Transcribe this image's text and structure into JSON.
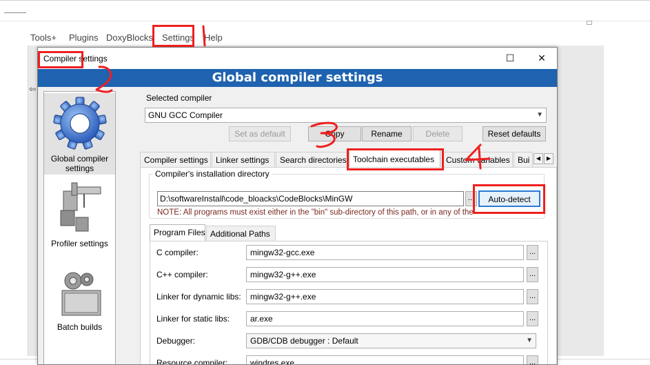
{
  "background": {
    "menu": [
      "Tools+",
      "Plugins",
      "DoxyBlocks",
      "Settings",
      "Help"
    ],
    "arrow_glyph": "⇦"
  },
  "dialog": {
    "title": "Compiler settings",
    "maximize_glyph": "☐",
    "close_glyph": "✕",
    "banner": "Global compiler settings",
    "categories": [
      {
        "label": "Global compiler settings",
        "icon": "gear-icon"
      },
      {
        "label": "Profiler settings",
        "icon": "profiler-icon"
      },
      {
        "label": "Batch builds",
        "icon": "batch-builds-icon"
      }
    ],
    "selected_compiler_label": "Selected compiler",
    "selected_compiler": "GNU GCC Compiler",
    "buttons": {
      "set_default": "Set as default",
      "copy": "Copy",
      "rename": "Rename",
      "delete": "Delete",
      "reset_defaults": "Reset defaults"
    },
    "tabs": [
      "Compiler settings",
      "Linker settings",
      "Search directories",
      "Toolchain executables",
      "Custom variables",
      "Bui"
    ],
    "active_tab": "Toolchain executables",
    "install_dir_label": "Compiler's installation directory",
    "install_dir": "D:\\softwareInstall\\code_bloacks\\CodeBlocks\\MinGW",
    "browse_label": "...",
    "auto_detect": "Auto-detect",
    "note": "NOTE: All programs must exist either in the \"bin\" sub-directory of this path, or in any of the",
    "subtabs": [
      "Program Files",
      "Additional Paths"
    ],
    "programs": [
      {
        "label": "C compiler:",
        "value": "mingw32-gcc.exe"
      },
      {
        "label": "C++ compiler:",
        "value": "mingw32-g++.exe"
      },
      {
        "label": "Linker for dynamic libs:",
        "value": "mingw32-g++.exe"
      },
      {
        "label": "Linker for static libs:",
        "value": "ar.exe"
      },
      {
        "label": "Debugger:",
        "value": "GDB/CDB debugger : Default"
      },
      {
        "label": "Resource compiler:",
        "value": "windres.exe"
      }
    ]
  },
  "annotations": {
    "color": "#ef1f1f",
    "digits": [
      "1",
      "2",
      "3",
      "4"
    ]
  }
}
